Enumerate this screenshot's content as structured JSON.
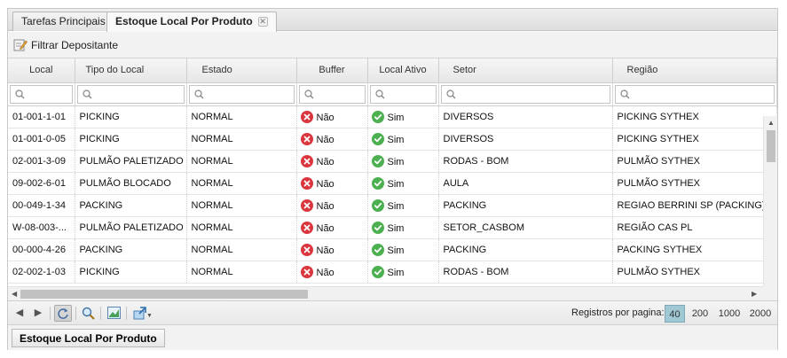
{
  "tabs": [
    {
      "label": "Tarefas Principais"
    },
    {
      "label": "Estoque Local Por Produto"
    }
  ],
  "toolbar": {
    "filter_label": "Filtrar Depositante"
  },
  "columns": [
    "Local",
    "Tipo do Local",
    "Estado",
    "Buffer",
    "Local Ativo",
    "Setor",
    "Região"
  ],
  "rows": [
    {
      "local": "01-001-1-01",
      "tipo": "PICKING",
      "estado": "NORMAL",
      "buffer": "Não",
      "ativo": "Sim",
      "setor": "DIVERSOS",
      "regiao": "PICKING SYTHEX"
    },
    {
      "local": "01-001-0-05",
      "tipo": "PICKING",
      "estado": "NORMAL",
      "buffer": "Não",
      "ativo": "Sim",
      "setor": "DIVERSOS",
      "regiao": "PICKING SYTHEX"
    },
    {
      "local": "02-001-3-09",
      "tipo": "PULMÃO PALETIZADO",
      "estado": "NORMAL",
      "buffer": "Não",
      "ativo": "Sim",
      "setor": "RODAS - BOM",
      "regiao": "PULMÃO SYTHEX"
    },
    {
      "local": "09-002-6-01",
      "tipo": "PULMÃO BLOCADO",
      "estado": "NORMAL",
      "buffer": "Não",
      "ativo": "Sim",
      "setor": "AULA",
      "regiao": "PULMÃO SYTHEX"
    },
    {
      "local": "00-049-1-34",
      "tipo": "PACKING",
      "estado": "NORMAL",
      "buffer": "Não",
      "ativo": "Sim",
      "setor": "PACKING",
      "regiao": "REGIAO BERRINI SP (PACKING)"
    },
    {
      "local": "W-08-003-...",
      "tipo": "PULMÃO PALETIZADO",
      "estado": "NORMAL",
      "buffer": "Não",
      "ativo": "Sim",
      "setor": "SETOR_CASBOM",
      "regiao": "REGIÃO CAS PL"
    },
    {
      "local": "00-000-4-26",
      "tipo": "PACKING",
      "estado": "NORMAL",
      "buffer": "Não",
      "ativo": "Sim",
      "setor": "PACKING",
      "regiao": "PACKING SYTHEX"
    },
    {
      "local": "02-002-1-03",
      "tipo": "PICKING",
      "estado": "NORMAL",
      "buffer": "Não",
      "ativo": "Sim",
      "setor": "RODAS - BOM",
      "regiao": "PULMÃO SYTHEX"
    }
  ],
  "pager": {
    "label": "Registros por pagina:",
    "options": [
      "40",
      "200",
      "1000",
      "2000"
    ],
    "selected": "40"
  },
  "footer": {
    "tab_label": "Estoque Local Por Produto"
  },
  "colors": {
    "no": "#d9363e",
    "yes": "#4cb050",
    "page_selected": "#9fc7d4"
  }
}
